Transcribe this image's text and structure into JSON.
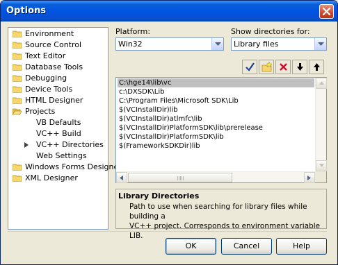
{
  "window": {
    "title": "Options"
  },
  "tree": {
    "items": [
      {
        "label": "Environment",
        "type": "folder"
      },
      {
        "label": "Source Control",
        "type": "folder"
      },
      {
        "label": "Text Editor",
        "type": "folder"
      },
      {
        "label": "Database Tools",
        "type": "folder"
      },
      {
        "label": "Debugging",
        "type": "folder"
      },
      {
        "label": "Device Tools",
        "type": "folder"
      },
      {
        "label": "HTML Designer",
        "type": "folder"
      },
      {
        "label": "Projects",
        "type": "open-folder"
      },
      {
        "label": "VB Defaults",
        "type": "child"
      },
      {
        "label": "VC++ Build",
        "type": "child"
      },
      {
        "label": "VC++ Directories",
        "type": "child-current"
      },
      {
        "label": "Web Settings",
        "type": "child"
      },
      {
        "label": "Windows Forms Designer",
        "type": "folder"
      },
      {
        "label": "XML Designer",
        "type": "folder"
      }
    ]
  },
  "platform": {
    "label": "Platform:",
    "value": "Win32"
  },
  "show_dirs": {
    "label": "Show directories for:",
    "value": "Library files"
  },
  "toolbar": {
    "icons": [
      "checkmark-icon",
      "new-folder-icon",
      "delete-icon",
      "move-down-icon",
      "move-up-icon"
    ]
  },
  "directories": [
    "C:\\hge14\\lib\\vc",
    "c:\\DXSDK\\Lib",
    "C:\\Program Files\\Microsoft SDK\\Lib",
    "$(VCInstallDir)lib",
    "$(VCInstallDir)atlmfc\\lib",
    "$(VCInstallDir)PlatformSDK\\lib\\prerelease",
    "$(VCInstallDir)PlatformSDK\\lib",
    "$(FrameworkSDKDir)lib"
  ],
  "description": {
    "title": "Library Directories",
    "line1": "Path to use when searching for library files while building a",
    "line2": "VC++ project. Corresponds to environment variable LIB."
  },
  "buttons": {
    "ok": "OK",
    "cancel": "Cancel",
    "help": "Help"
  },
  "colors": {
    "titlebar": "#0054e3",
    "selection": "#c0c0c0",
    "dialog_bg": "#ece9d8"
  }
}
